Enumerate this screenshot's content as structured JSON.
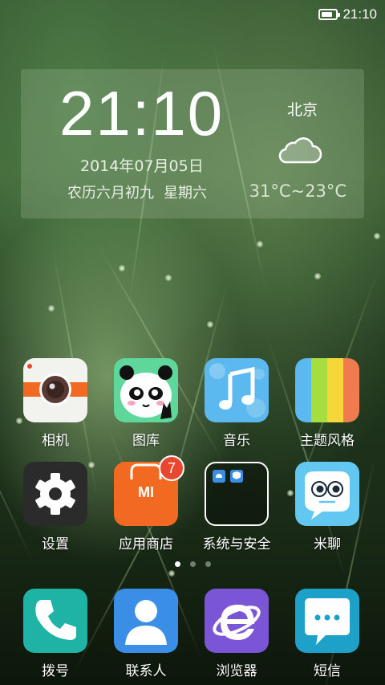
{
  "status_bar": {
    "time": "21:10",
    "battery_icon": "battery-icon"
  },
  "widget": {
    "time": "21:10",
    "date": "2014年07月05日",
    "lunar_date": "农历六月初九",
    "weekday": "星期六",
    "city": "北京",
    "weather_icon": "cloud-icon",
    "temperature": "31°C~23°C"
  },
  "apps_row1": [
    {
      "label": "相机",
      "icon": "camera-icon"
    },
    {
      "label": "图库",
      "icon": "gallery-icon"
    },
    {
      "label": "音乐",
      "icon": "music-icon"
    },
    {
      "label": "主题风格",
      "icon": "themes-icon"
    }
  ],
  "apps_row2": [
    {
      "label": "设置",
      "icon": "settings-icon"
    },
    {
      "label": "应用商店",
      "icon": "app-store-icon",
      "badge": "7",
      "icon_text": "MI"
    },
    {
      "label": "系统与安全",
      "icon": "folder-icon"
    },
    {
      "label": "米聊",
      "icon": "miliao-icon"
    }
  ],
  "dock": [
    {
      "label": "拨号",
      "icon": "phone-icon"
    },
    {
      "label": "联系人",
      "icon": "contacts-icon"
    },
    {
      "label": "浏览器",
      "icon": "browser-icon"
    },
    {
      "label": "短信",
      "icon": "messages-icon"
    }
  ],
  "pages": {
    "count": 3,
    "active": 0
  },
  "colors": {
    "camera": "#f2f2ef",
    "gallery": "#5fd79a",
    "music": "#5bb9ef",
    "settings": "#2b2b2b",
    "store": "#f26a22",
    "miliao": "#63c8f1",
    "phone": "#1fb3a5",
    "contacts": "#3a8ee6",
    "browser": "#7a55d6",
    "messages": "#1da1c8"
  }
}
